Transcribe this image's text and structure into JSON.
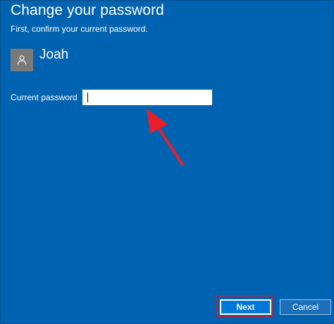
{
  "dialog": {
    "title": "Change your password",
    "subtitle": "First, confirm your current password."
  },
  "user": {
    "name": "Joah",
    "avatar_icon": "person-icon"
  },
  "current_password": {
    "label": "Current password",
    "value": "",
    "placeholder": ""
  },
  "buttons": {
    "next_label": "Next",
    "cancel_label": "Cancel"
  },
  "colors": {
    "background": "#0063b1",
    "annotation": "#e8202a",
    "highlight_box": "#b5263f"
  }
}
